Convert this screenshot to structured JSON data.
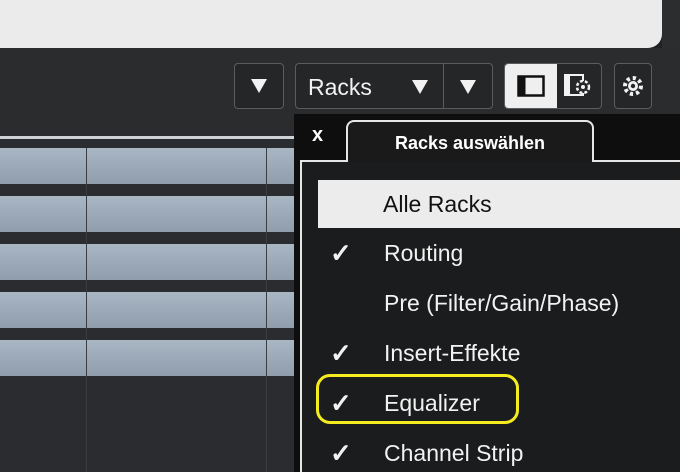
{
  "toolbar": {
    "racks_label": "Racks"
  },
  "popup": {
    "close_label": "x",
    "title": "Racks auswählen",
    "all_racks": "Alle Racks",
    "items": [
      {
        "label": "Routing",
        "checked": true,
        "check": "✓"
      },
      {
        "label": "Pre (Filter/Gain/Phase)",
        "checked": false,
        "check": ""
      },
      {
        "label": "Insert-Effekte",
        "checked": true,
        "check": "✓"
      },
      {
        "label": "Equalizer",
        "checked": true,
        "check": "✓",
        "highlighted": true
      },
      {
        "label": "Channel Strip",
        "checked": true,
        "check": "✓"
      }
    ]
  },
  "colors": {
    "highlight": "#f5ec1f",
    "lane": "#9aa8b7",
    "popup_bg": "#1b1c1d"
  }
}
